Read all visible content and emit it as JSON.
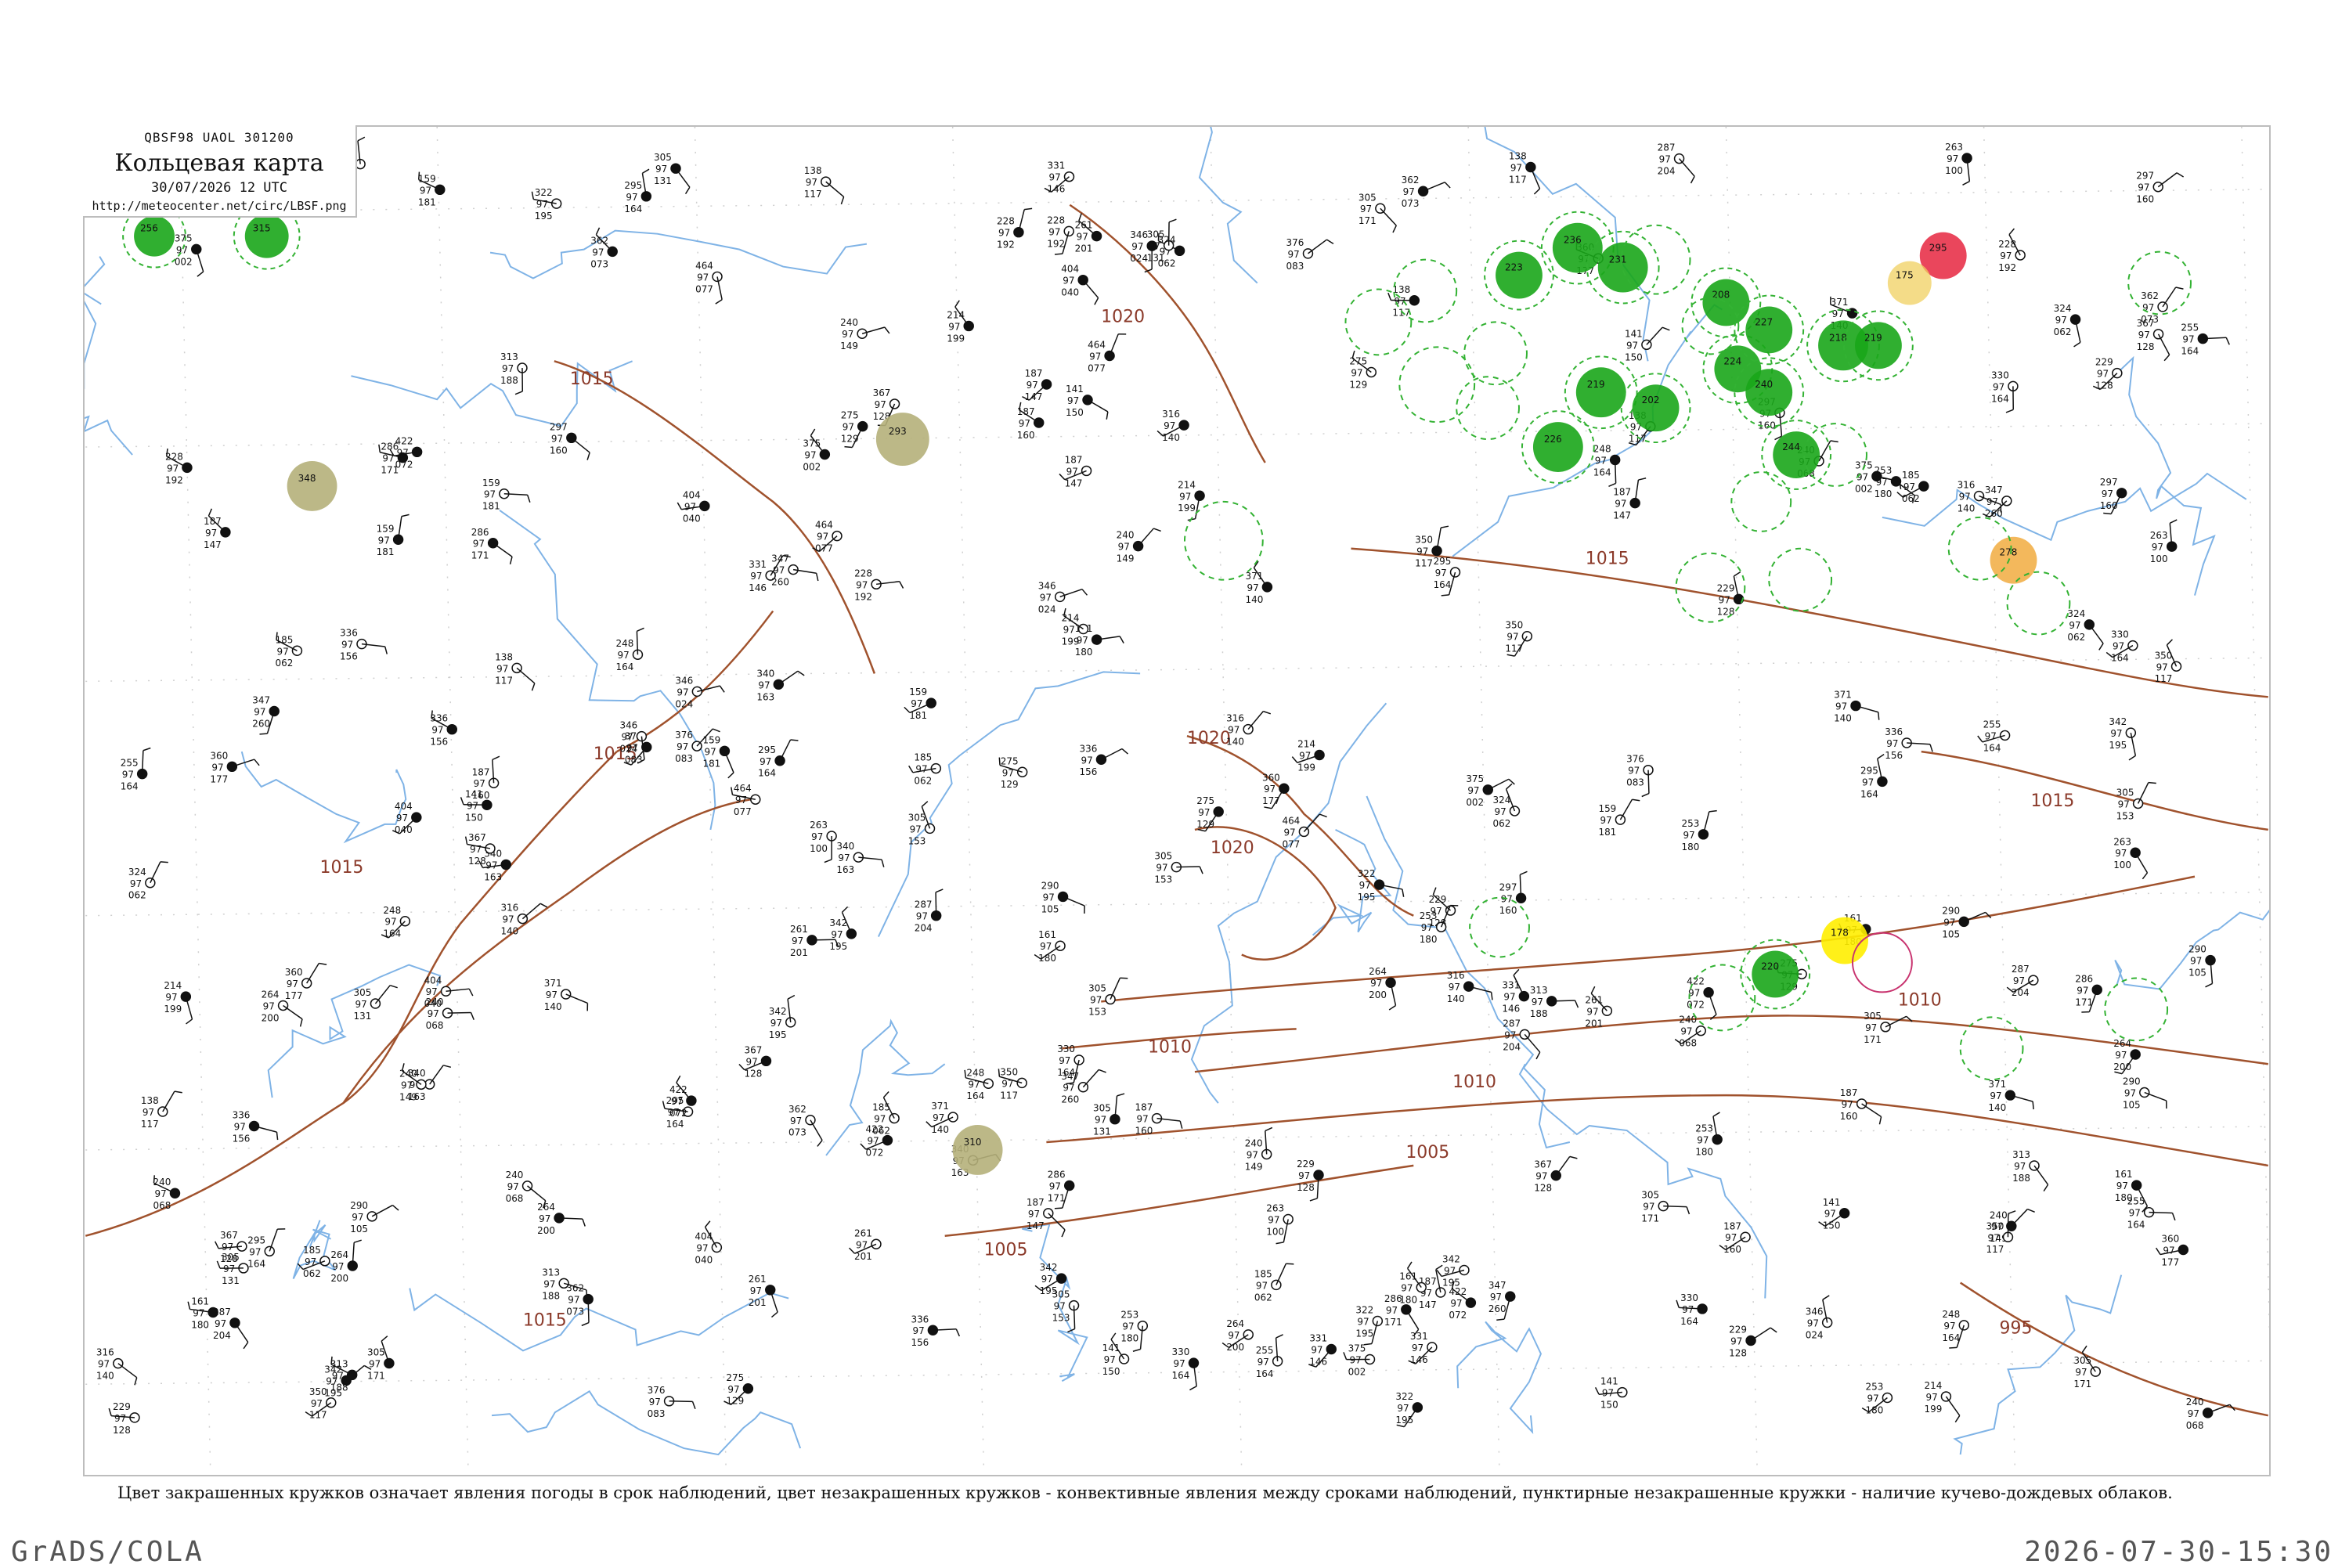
{
  "header": {
    "code_line": "QBSF98  UAOL  301200",
    "title": "Кольцевая карта",
    "date": "30/07/2026 12 UTC",
    "url": "http://meteocenter.net/circ/LBSF.png"
  },
  "caption": "Цвет закрашенных кружков означает явления погоды в срок наблюдений, цвет незакрашенных кружков - конвективные явления между сроками наблюдений, пунктирные незакрашенные кружки - наличие кучево-дождевых облаков.",
  "footer": {
    "left": "GrADS/COLA",
    "right": "2026-07-30-15:30"
  },
  "isobars": [
    {
      "label": "1015"
    },
    {
      "label": "1015"
    },
    {
      "label": "1015"
    },
    {
      "label": "1015"
    },
    {
      "label": "1020"
    },
    {
      "label": "1020"
    },
    {
      "label": "1020"
    },
    {
      "label": "1010"
    },
    {
      "label": "1010"
    },
    {
      "label": "1010"
    },
    {
      "label": "1005"
    },
    {
      "label": "1005"
    },
    {
      "label": "1015"
    },
    {
      "label": "1015"
    },
    {
      "label": "995"
    }
  ],
  "colors": {
    "isobar": "#a0522d",
    "river": "#7fb3e6",
    "rain": "#1aa61a",
    "rain_dashed": "#33b233",
    "fog": "#b5b07a",
    "thunder": "#e8324a",
    "haze": "#f0d060",
    "dust": "#f2b04a",
    "bright": "#ffee00",
    "magenta": "#c8326e"
  },
  "highlight_stations": [
    {
      "type": "rain",
      "label": "256"
    },
    {
      "type": "rain",
      "label": "315"
    },
    {
      "type": "fog",
      "label": "348"
    },
    {
      "type": "fog",
      "label": "293"
    },
    {
      "type": "rain",
      "label": "226"
    },
    {
      "type": "rain",
      "label": "219"
    },
    {
      "type": "rain",
      "label": "223"
    },
    {
      "type": "rain",
      "label": "236"
    },
    {
      "type": "rain",
      "label": "231"
    },
    {
      "type": "rain",
      "label": "202"
    },
    {
      "type": "rain",
      "label": "224"
    },
    {
      "type": "rain",
      "label": "208"
    },
    {
      "type": "rain",
      "label": "227"
    },
    {
      "type": "rain",
      "label": "240"
    },
    {
      "type": "rain",
      "label": "244"
    },
    {
      "type": "rain",
      "label": "218"
    },
    {
      "type": "rain",
      "label": "219"
    },
    {
      "type": "thunder",
      "label": "295"
    },
    {
      "type": "haze",
      "label": "175"
    },
    {
      "type": "dust",
      "label": "278"
    },
    {
      "type": "bright",
      "label": "178"
    },
    {
      "type": "rain",
      "label": "220"
    },
    {
      "type": "fog",
      "label": "310"
    }
  ],
  "stations": [
    {
      "t": "161",
      "p": "97",
      "d": "180"
    },
    {
      "t": "159",
      "p": "97",
      "d": "181"
    },
    {
      "t": "214",
      "p": "97",
      "d": "199"
    },
    {
      "t": "350",
      "p": "97",
      "d": "117"
    },
    {
      "t": "367",
      "p": "97",
      "d": "128"
    },
    {
      "t": "371",
      "p": "97",
      "d": "140"
    },
    {
      "t": "305",
      "p": "97",
      "d": "153"
    },
    {
      "t": "295",
      "p": "97",
      "d": "164"
    },
    {
      "t": "275",
      "p": "97",
      "d": "129"
    },
    {
      "t": "229",
      "p": "97",
      "d": "128"
    },
    {
      "t": "253",
      "p": "97",
      "d": "180"
    },
    {
      "t": "187",
      "p": "97",
      "d": "147"
    },
    {
      "t": "141",
      "p": "97",
      "d": "150"
    },
    {
      "t": "185",
      "p": "97",
      "d": "062"
    },
    {
      "t": "240",
      "p": "97",
      "d": "068"
    },
    {
      "t": "342",
      "p": "97",
      "d": "195"
    },
    {
      "t": "264",
      "p": "97",
      "d": "200"
    },
    {
      "t": "138",
      "p": "97",
      "d": "117"
    },
    {
      "t": "336",
      "p": "97",
      "d": "156"
    },
    {
      "t": "316",
      "p": "97",
      "d": "140"
    },
    {
      "t": "360",
      "p": "97",
      "d": "177"
    },
    {
      "t": "290",
      "p": "97",
      "d": "105"
    },
    {
      "t": "347",
      "p": "97",
      "d": "260"
    },
    {
      "t": "330",
      "p": "97",
      "d": "164"
    },
    {
      "t": "305",
      "p": "97",
      "d": "131"
    },
    {
      "t": "331",
      "p": "97",
      "d": "146"
    },
    {
      "t": "322",
      "p": "97",
      "d": "195"
    },
    {
      "t": "297",
      "p": "97",
      "d": "160"
    },
    {
      "t": "313",
      "p": "97",
      "d": "188"
    },
    {
      "t": "340",
      "p": "97",
      "d": "163"
    },
    {
      "t": "305",
      "p": "97",
      "d": "171"
    },
    {
      "t": "228",
      "p": "97",
      "d": "192"
    },
    {
      "t": "187",
      "p": "97",
      "d": "160"
    },
    {
      "t": "263",
      "p": "97",
      "d": "100"
    },
    {
      "t": "261",
      "p": "97",
      "d": "201"
    },
    {
      "t": "248",
      "p": "97",
      "d": "164"
    },
    {
      "t": "286",
      "p": "97",
      "d": "171"
    },
    {
      "t": "240",
      "p": "97",
      "d": "149"
    },
    {
      "t": "287",
      "p": "97",
      "d": "204"
    },
    {
      "t": "255",
      "p": "97",
      "d": "164"
    },
    {
      "t": "346",
      "p": "97",
      "d": "024"
    },
    {
      "t": "422",
      "p": "97",
      "d": "072"
    },
    {
      "t": "404",
      "p": "97",
      "d": "040"
    },
    {
      "t": "324",
      "p": "97",
      "d": "062"
    },
    {
      "t": "464",
      "p": "97",
      "d": "077"
    },
    {
      "t": "362",
      "p": "97",
      "d": "073"
    },
    {
      "t": "376",
      "p": "97",
      "d": "083"
    },
    {
      "t": "375",
      "p": "97",
      "d": "002"
    }
  ]
}
